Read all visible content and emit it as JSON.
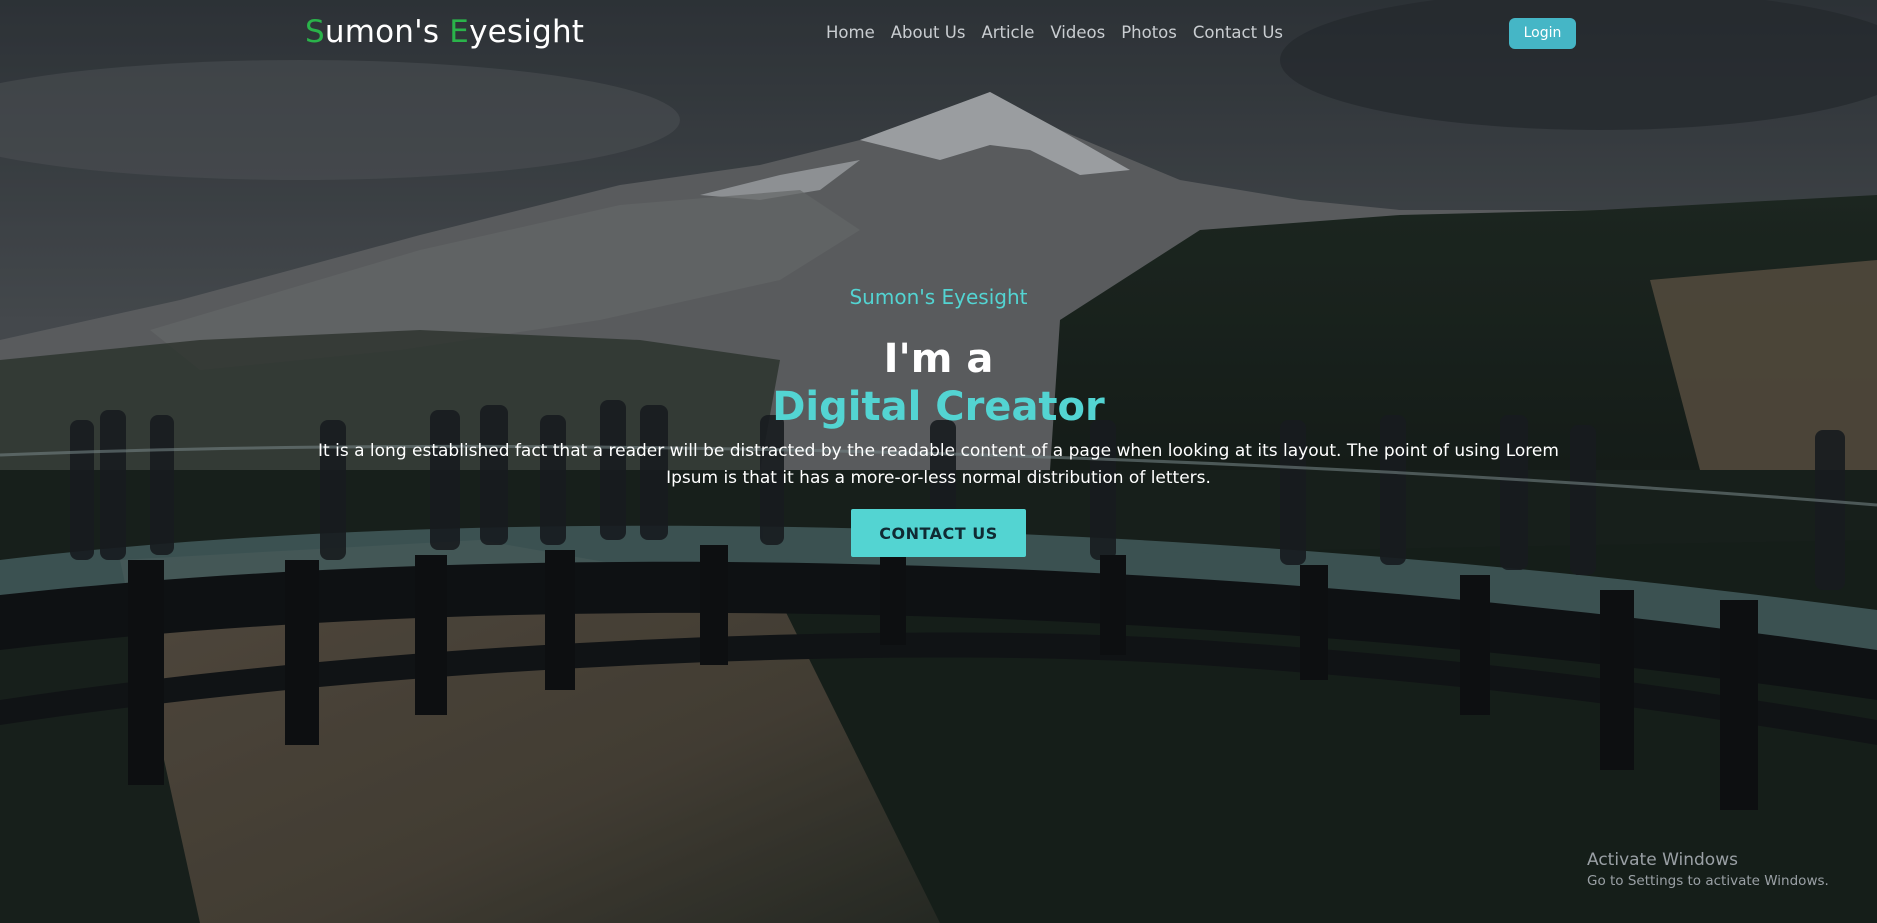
{
  "brand": {
    "first_initial": "S",
    "first_rest": "umon's",
    "second_initial": "E",
    "second_rest": "yesight",
    "accent_color": "#2ab34a"
  },
  "nav": {
    "links": [
      "Home",
      "About Us",
      "Article",
      "Videos",
      "Photos",
      "Contact Us"
    ],
    "login_label": "Login"
  },
  "hero": {
    "subtitle": "Sumon's Eyesight",
    "headline_line1": "I'm a",
    "headline_line2": "Digital Creator",
    "description": "It is a long established fact that a reader will be distracted by the readable content of a page when looking at its layout. The point of using Lorem Ipsum is that it has a more-or-less normal distribution of letters.",
    "cta_label": "CONTACT US",
    "accent_color": "#53d4d2"
  },
  "watermark": {
    "title": "Activate Windows",
    "subtitle": "Go to Settings to activate Windows."
  }
}
